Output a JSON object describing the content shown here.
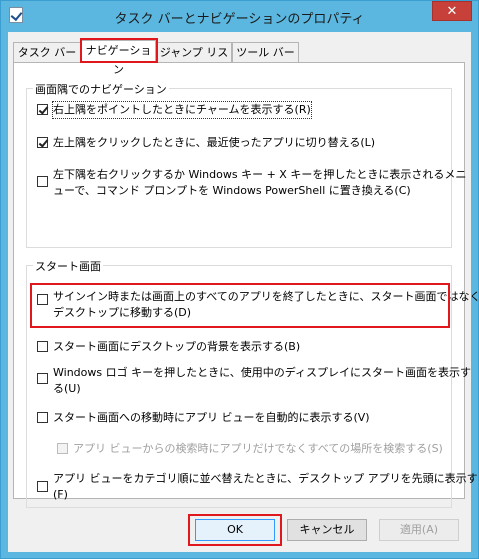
{
  "window": {
    "title": "タスク バーとナビゲーションのプロパティ",
    "close_glyph": "✕"
  },
  "tabs": [
    {
      "label": "タスク バー"
    },
    {
      "label": "ナビゲーション"
    },
    {
      "label": "ジャンプ リスト"
    },
    {
      "label": "ツール バー"
    }
  ],
  "corner_nav": {
    "legend": "画面隅でのナビゲーション",
    "options": [
      {
        "label": "右上隅をポイントしたときにチャームを表示する(R)",
        "checked": true
      },
      {
        "label": "左上隅をクリックしたときに、最近使ったアプリに切り替える(L)",
        "checked": true
      },
      {
        "label_line1": "左下隅を右クリックするか Windows キー + X キーを押したときに表示されるメニ",
        "label_line2": "ューで、コマンド プロンプトを Windows PowerShell に置き換える(C)",
        "checked": false
      }
    ]
  },
  "start_screen": {
    "legend": "スタート画面",
    "options": [
      {
        "label_line1": "サインイン時または画面上のすべてのアプリを終了したときに、スタート画面ではなく",
        "label_line2": "デスクトップに移動する(D)",
        "checked": false
      },
      {
        "label": "スタート画面にデスクトップの背景を表示する(B)",
        "checked": false
      },
      {
        "label_line1": "Windows ロゴ キーを押したときに、使用中のディスプレイにスタート画面を表示す",
        "label_line2": "る(U)",
        "checked": false
      },
      {
        "label": "スタート画面への移動時にアプリ ビューを自動的に表示する(V)",
        "checked": false
      },
      {
        "label": "アプリ ビューからの検索時にアプリだけでなくすべての場所を検索する(S)",
        "checked": false,
        "disabled": true
      },
      {
        "label_line1": "アプリ ビューをカテゴリ順に並べ替えたときに、デスクトップ アプリを先頭に表示する",
        "label_line2": "(F)",
        "checked": false
      }
    ]
  },
  "buttons": {
    "ok": "OK",
    "cancel": "キャンセル",
    "apply": "適用(A)"
  }
}
